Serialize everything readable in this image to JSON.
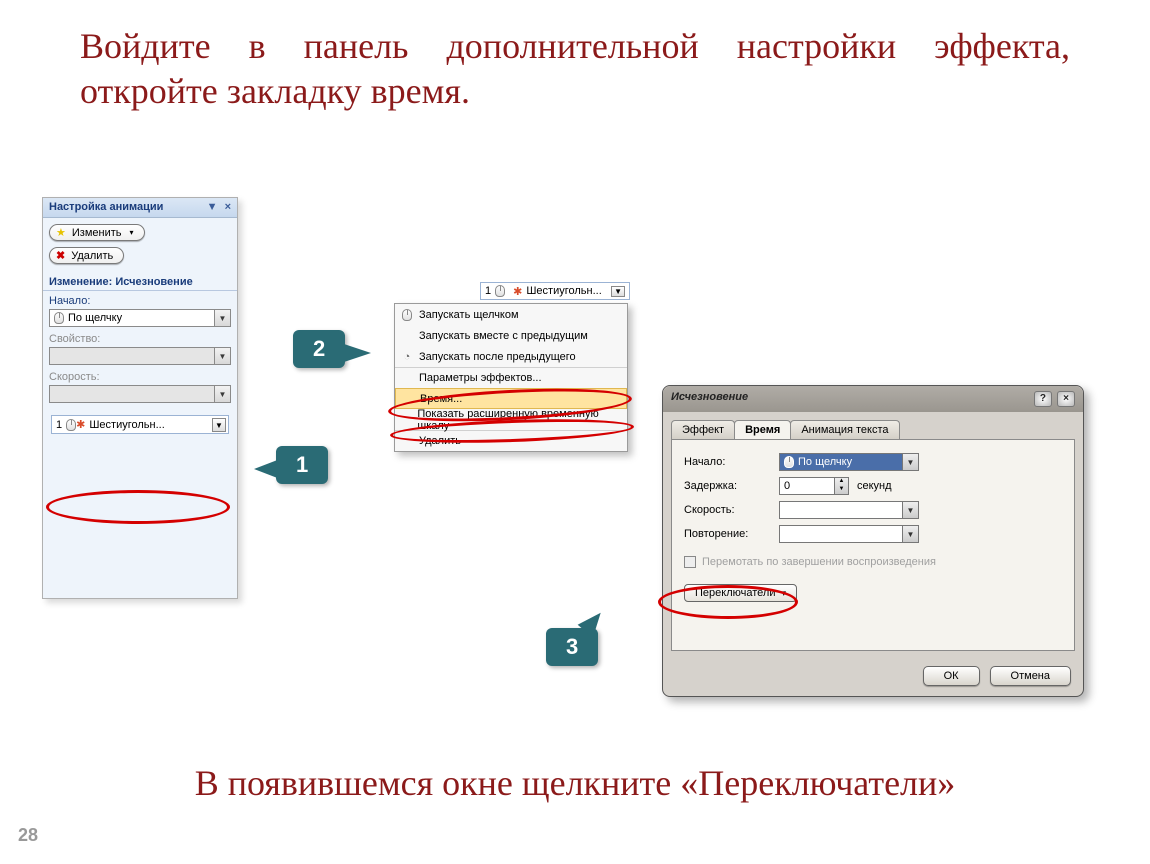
{
  "slide": {
    "title_text": "Войдите в панель дополнительной настройки эффекта, откройте закладку время.",
    "bottom_text": "В появившемся окне щелкните «Переключатели»",
    "page_number": "28"
  },
  "callouts": {
    "c1": "1",
    "c2": "2",
    "c3": "3"
  },
  "anim_pane": {
    "title": "Настройка анимации",
    "btn_change": "Изменить",
    "btn_delete": "Удалить",
    "section_change": "Изменение: Исчезновение",
    "f_start_label": "Начало:",
    "f_start_value": "По щелчку",
    "f_prop_label": "Свойство:",
    "f_speed_label": "Скорость:",
    "item_num": "1",
    "item_name": "Шестиугольн..."
  },
  "headline_item": {
    "num": "1",
    "name": "Шестиугольн..."
  },
  "ctx": {
    "m1": "Запускать щелчком",
    "m2": "Запускать вместе с предыдущим",
    "m3": "Запускать после предыдущего",
    "m4": "Параметры эффектов...",
    "m5": "Время...",
    "m6": "Показать расширенную временную шкалу",
    "m7": "Удалить"
  },
  "dialog": {
    "title": "Исчезновение",
    "tab_effect": "Эффект",
    "tab_time": "Время",
    "tab_textanim": "Анимация текста",
    "lbl_start": "Начало:",
    "val_start": "По щелчку",
    "lbl_delay": "Задержка:",
    "val_delay": "0",
    "unit_sec": "секунд",
    "lbl_speed": "Скорость:",
    "lbl_repeat": "Повторение:",
    "chk_rewind": "Перемотать по завершении воспроизведения",
    "btn_triggers": "Переключатели",
    "btn_ok": "ОК",
    "btn_cancel": "Отмена"
  }
}
